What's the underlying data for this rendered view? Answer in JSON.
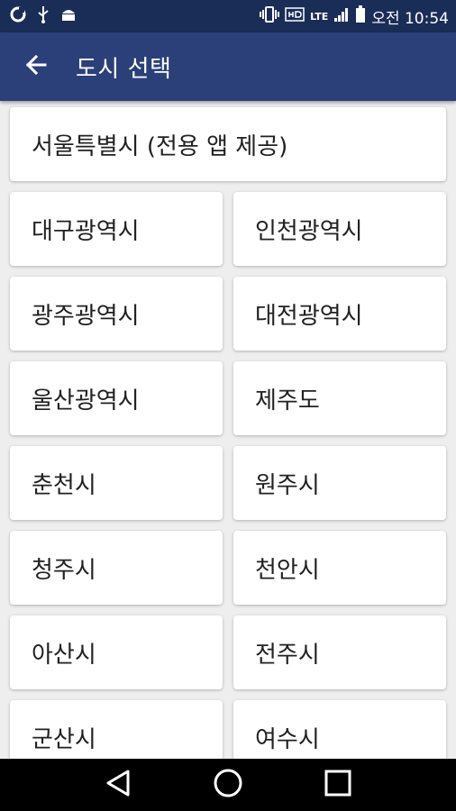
{
  "status_bar": {
    "left_icons": [
      "app-notification-icon",
      "usb-icon",
      "android-debug-icon"
    ],
    "right_icons": [
      "vibrate-icon",
      "hd-voice-icon",
      "lte-icon",
      "signal-icon",
      "battery-icon"
    ],
    "lte_label": "LTE",
    "time": "오전 10:54"
  },
  "app_bar": {
    "title": "도시 선택",
    "back_icon": "arrow-back-icon",
    "color": "#2b4079"
  },
  "cities": {
    "featured": "서울특별시 (전용 앱 제공)",
    "items": [
      "대구광역시",
      "인천광역시",
      "광주광역시",
      "대전광역시",
      "울산광역시",
      "제주도",
      "춘천시",
      "원주시",
      "청주시",
      "천안시",
      "아산시",
      "전주시",
      "군산시",
      "여수시"
    ]
  },
  "nav_bar": {
    "buttons": [
      "back-triangle-icon",
      "home-circle-icon",
      "recents-square-icon"
    ]
  }
}
